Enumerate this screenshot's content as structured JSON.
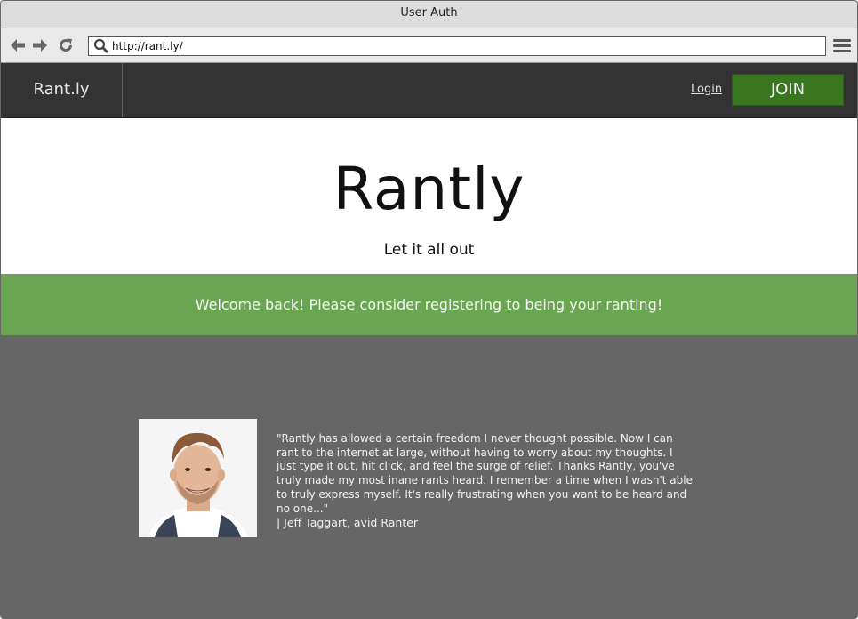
{
  "window": {
    "title": "User Auth"
  },
  "browser": {
    "url": "http://rant.ly/",
    "icons": [
      "back-arrow-icon",
      "forward-arrow-icon",
      "reload-icon",
      "search-icon",
      "hamburger-menu-icon"
    ]
  },
  "nav": {
    "brand": "Rant.ly",
    "login_label": "Login",
    "join_label": "JOIN"
  },
  "hero": {
    "title": "Rantly",
    "subtitle": "Let it all out"
  },
  "notice": {
    "message": "Welcome back! Please consider registering to being your ranting!"
  },
  "testimonial": {
    "quote": "\"Rantly has allowed a certain freedom I never thought possible. Now I can rant to the internet at large, without having to worry about my thoughts. I just type it out, hit click, and feel the surge of relief. Thanks Rantly, you've truly made my most inane rants heard. I remember a time when I wasn't able to truly express myself. It's really frustrating when you want to be heard and no one...\"",
    "author": "| Jeff Taggart, avid Ranter"
  },
  "colors": {
    "nav_bg": "#333333",
    "join_button": "#3a7520",
    "notice_bg": "#6aa551",
    "testimonial_bg": "#666666"
  }
}
